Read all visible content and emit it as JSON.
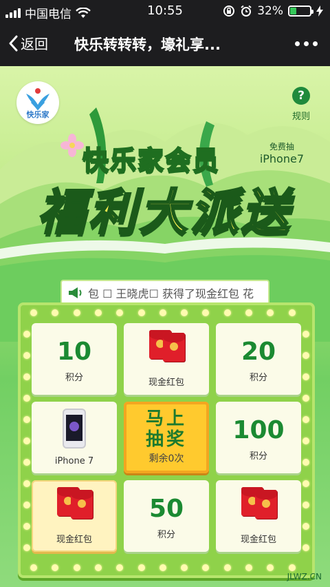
{
  "status_bar": {
    "carrier": "中国电信",
    "time": "10:55",
    "battery": "32%",
    "battery_level": 0.32
  },
  "nav": {
    "back_label": "返回",
    "title": "快乐转转转，壕礼享..."
  },
  "header": {
    "logo_text": "快乐家",
    "rules_label": "规则",
    "free_draw_top": "免费抽",
    "free_draw_prize": "iPhone7",
    "title_sub": "快乐家会员",
    "title_main": "福利大派送"
  },
  "marquee": {
    "text": "包 ☐ 王晓虎☐ 获得了现金红包 花"
  },
  "prizes": [
    {
      "value": "10",
      "label": "积分"
    },
    {
      "value": "",
      "label": "现金红包"
    },
    {
      "value": "20",
      "label": "积分"
    },
    {
      "value": "100",
      "label": "积分"
    },
    {
      "value": "",
      "label": "现金红包"
    },
    {
      "value": "50",
      "label": "积分"
    },
    {
      "value": "",
      "label": "现金红包"
    },
    {
      "value": "",
      "label": "iPhone 7"
    }
  ],
  "draw_button": {
    "line1": "马上",
    "line2": "抽奖",
    "remaining": "剩余0次"
  },
  "watermark": {
    "text": "JLWZ.CN"
  },
  "colors": {
    "accent_green": "#1b8a32",
    "button_yellow": "#ffca2e",
    "red_packet": "#e01f2a"
  }
}
